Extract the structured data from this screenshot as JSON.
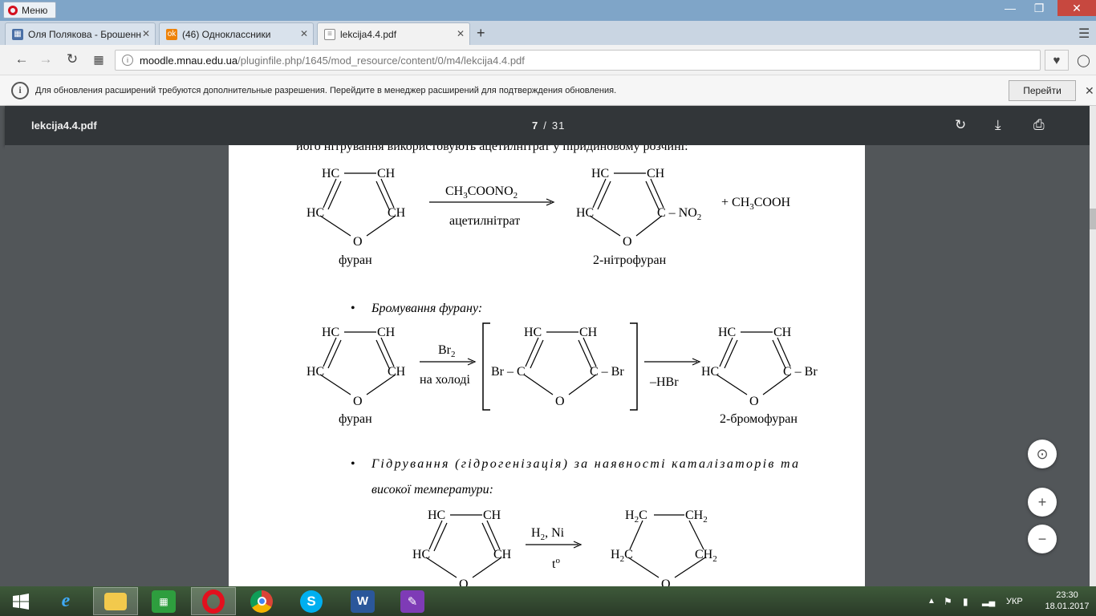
{
  "browser": {
    "menu_label": "Меню",
    "tabs": [
      {
        "label": "Оля Полякова - Брошенн",
        "icon": "document-icon",
        "color": "#4a6fa5"
      },
      {
        "label": "(46) Одноклассники",
        "icon": "odnoklassniki-icon",
        "color": "#ee8208"
      },
      {
        "label": "lekcija4.4.pdf",
        "icon": "pdf-file-icon",
        "color": "#888888",
        "active": true
      }
    ],
    "url_host": "moodle.mnau.edu.ua",
    "url_path": "/pluginfile.php/1645/mod_resource/content/0/m4/lekcija4.4.pdf",
    "notification_text": "Для обновления расширений требуются дополнительные разрешения. Перейдите в менеджер расширений для подтверждения обновления.",
    "notification_button": "Перейти"
  },
  "pdf_viewer": {
    "file_name": "lekcija4.4.pdf",
    "current_page": "7",
    "page_separator": "/",
    "total_pages": "31"
  },
  "document": {
    "intro_line": "його нітрування використовують ацетилнітрат у піридиновому розчині:",
    "nitration": {
      "furan_top_left": "HC",
      "furan_top_right": "CH",
      "furan_left": "HC",
      "furan_right": "CH",
      "oxygen": "O",
      "reactant_name": "фуран",
      "reagent_main": "CH",
      "reagent_sub": "3",
      "reagent_tail": "COONO",
      "reagent_sub2": "2",
      "reagent_name": "ацетилнітрат",
      "product_right_c": "C – NO",
      "product_right_sub": "2",
      "byproduct_prefix": "+ CH",
      "byproduct_sub": "3",
      "byproduct_tail": "COOH",
      "product_name": "2-нітрофуран"
    },
    "bromination": {
      "bullet": "•",
      "heading": "Бромування фурану:",
      "reagent_main": "Br",
      "reagent_sub": "2",
      "condition": "на холоді",
      "intermediate_left": "Br – C",
      "intermediate_right": "C – Br",
      "elimination": "–HBr",
      "product_right": "C – Br",
      "reactant_name": "фуран",
      "product_name": "2-бромофуран"
    },
    "hydrogenation": {
      "bullet": "•",
      "heading_line1": "Гідрування (гідрогенізація) за наявності каталізаторів та",
      "heading_line2": "високої температури:",
      "reagent": "H",
      "reagent_sub": "2",
      "reagent_tail": ", Ni",
      "condition": "t",
      "condition_sup": "o",
      "product_top_left": "H",
      "product_top_left_sub": "2",
      "product_top_left_tail": "C",
      "product_top_right": "CH",
      "product_top_right_sub": "2",
      "product_left": "H",
      "product_left_sub": "2",
      "product_left_tail": "C",
      "product_right": "CH",
      "product_right_sub": "2"
    }
  },
  "taskbar": {
    "apps": [
      "internet-explorer-icon",
      "file-explorer-icon",
      "store-icon",
      "opera-icon",
      "chrome-icon",
      "skype-icon",
      "word-icon",
      "onenote-icon"
    ],
    "language": "УКР",
    "time": "23:30",
    "date": "18.01.2017"
  }
}
